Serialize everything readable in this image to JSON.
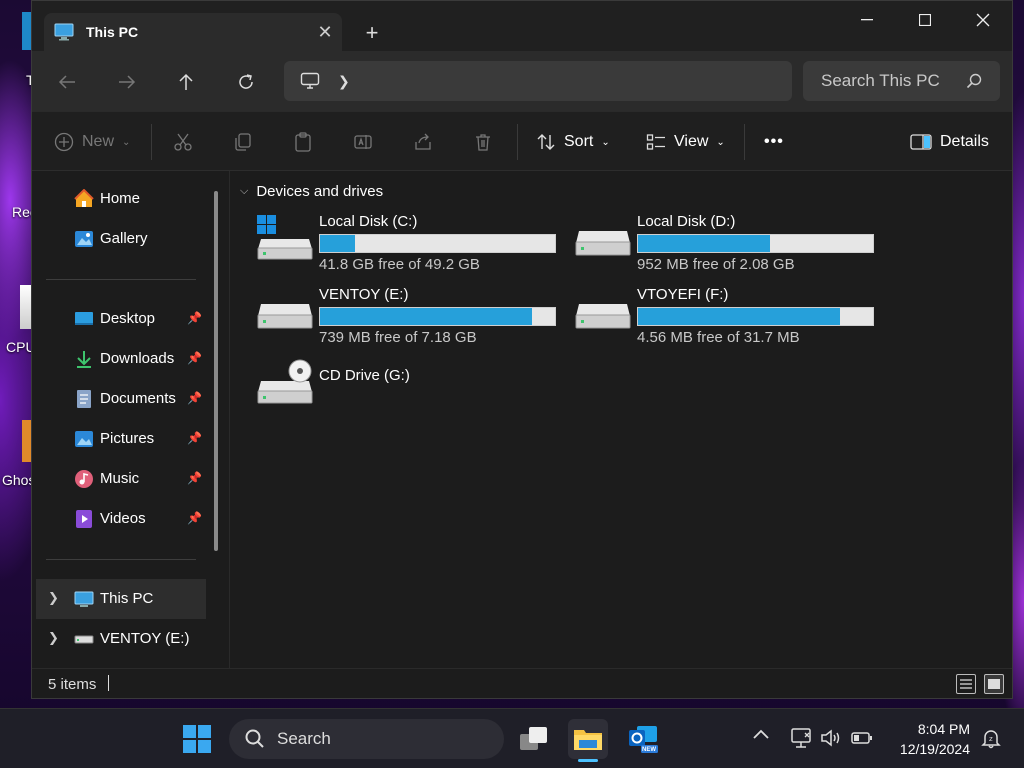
{
  "desktop": {
    "icons": [
      {
        "label": "T"
      },
      {
        "label": "Rec"
      },
      {
        "label": "CPU"
      },
      {
        "label": "Ghos"
      }
    ]
  },
  "window": {
    "tab_title": "This PC",
    "new_tab_symbol": "+",
    "controls": {
      "minimize": "—",
      "maximize": "☐",
      "close": "✕"
    }
  },
  "navbar": {
    "address_icon": "monitor-icon",
    "search_placeholder": "Search This PC"
  },
  "toolbar": {
    "new_label": "New",
    "sort_label": "Sort",
    "view_label": "View",
    "more_label": "•••",
    "details_label": "Details"
  },
  "sidebar": {
    "items": [
      {
        "label": "Home",
        "icon": "home-icon"
      },
      {
        "label": "Gallery",
        "icon": "gallery-icon"
      },
      {
        "label": "Desktop",
        "icon": "desktop-icon",
        "pinned": true
      },
      {
        "label": "Downloads",
        "icon": "downloads-icon",
        "pinned": true
      },
      {
        "label": "Documents",
        "icon": "documents-icon",
        "pinned": true
      },
      {
        "label": "Pictures",
        "icon": "pictures-icon",
        "pinned": true
      },
      {
        "label": "Music",
        "icon": "music-icon",
        "pinned": true
      },
      {
        "label": "Videos",
        "icon": "videos-icon",
        "pinned": true
      },
      {
        "label": "This PC",
        "icon": "this-pc-icon",
        "selected": true
      },
      {
        "label": "VENTOY (E:)",
        "icon": "drive-icon"
      }
    ]
  },
  "content": {
    "section_title": "Devices and drives",
    "drives": [
      {
        "name": "Local Disk (C:)",
        "free": "41.8 GB free of 49.2 GB",
        "used_fraction": 0.15,
        "icon": "system-drive-icon"
      },
      {
        "name": "Local Disk (D:)",
        "free": "952 MB free of 2.08 GB",
        "used_fraction": 0.56,
        "icon": "drive-icon"
      },
      {
        "name": "VENTOY (E:)",
        "free": "739 MB free of 7.18 GB",
        "used_fraction": 0.9,
        "icon": "drive-icon"
      },
      {
        "name": "VTOYEFI (F:)",
        "free": "4.56 MB free of 31.7 MB",
        "used_fraction": 0.86,
        "icon": "drive-icon"
      },
      {
        "name": "CD Drive (G:)",
        "free": "",
        "used_fraction": null,
        "icon": "cd-drive-icon"
      }
    ],
    "bar_color": "#26a0da"
  },
  "statusbar": {
    "item_count": "5 items"
  },
  "taskbar": {
    "search_label": "Search",
    "time": "8:04 PM",
    "date": "12/19/2024",
    "new_badge": "NEW"
  }
}
